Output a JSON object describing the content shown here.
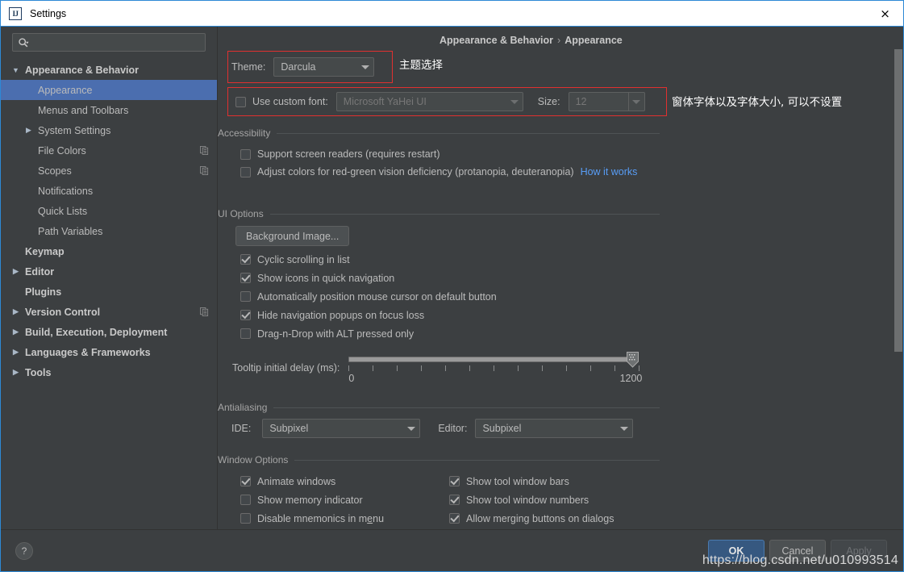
{
  "window": {
    "title": "Settings",
    "app_icon": "intellij-idea-icon",
    "close_label": "×",
    "accent_border": "#2d89d6"
  },
  "sidebar": {
    "search": {
      "placeholder": "",
      "value": "",
      "icon": "search-icon"
    },
    "items": [
      {
        "label": "Appearance & Behavior",
        "indent": 0,
        "twisty": "expanded",
        "bold": true,
        "selected": false,
        "copy": false
      },
      {
        "label": "Appearance",
        "indent": 1,
        "twisty": "none",
        "bold": false,
        "selected": true,
        "copy": false
      },
      {
        "label": "Menus and Toolbars",
        "indent": 1,
        "twisty": "none",
        "bold": false,
        "selected": false,
        "copy": false
      },
      {
        "label": "System Settings",
        "indent": 1,
        "twisty": "collapsed",
        "bold": false,
        "selected": false,
        "copy": false
      },
      {
        "label": "File Colors",
        "indent": 1,
        "twisty": "none",
        "bold": false,
        "selected": false,
        "copy": true
      },
      {
        "label": "Scopes",
        "indent": 1,
        "twisty": "none",
        "bold": false,
        "selected": false,
        "copy": true
      },
      {
        "label": "Notifications",
        "indent": 1,
        "twisty": "none",
        "bold": false,
        "selected": false,
        "copy": false
      },
      {
        "label": "Quick Lists",
        "indent": 1,
        "twisty": "none",
        "bold": false,
        "selected": false,
        "copy": false
      },
      {
        "label": "Path Variables",
        "indent": 1,
        "twisty": "none",
        "bold": false,
        "selected": false,
        "copy": false
      },
      {
        "label": "Keymap",
        "indent": 0,
        "twisty": "none",
        "bold": true,
        "selected": false,
        "copy": false
      },
      {
        "label": "Editor",
        "indent": 0,
        "twisty": "collapsed",
        "bold": true,
        "selected": false,
        "copy": false
      },
      {
        "label": "Plugins",
        "indent": 0,
        "twisty": "none",
        "bold": true,
        "selected": false,
        "copy": false
      },
      {
        "label": "Version Control",
        "indent": 0,
        "twisty": "collapsed",
        "bold": true,
        "selected": false,
        "copy": true
      },
      {
        "label": "Build, Execution, Deployment",
        "indent": 0,
        "twisty": "collapsed",
        "bold": true,
        "selected": false,
        "copy": false
      },
      {
        "label": "Languages & Frameworks",
        "indent": 0,
        "twisty": "collapsed",
        "bold": true,
        "selected": false,
        "copy": false
      },
      {
        "label": "Tools",
        "indent": 0,
        "twisty": "collapsed",
        "bold": true,
        "selected": false,
        "copy": false
      }
    ]
  },
  "breadcrumb": {
    "root": "Appearance & Behavior",
    "separator": "›",
    "leaf": "Appearance"
  },
  "theme_row": {
    "label": "Theme:",
    "value": "Darcula",
    "annotation": "主题选择"
  },
  "font_row": {
    "checkbox_label": "Use custom font:",
    "checked": false,
    "font_value": "Microsoft YaHei UI",
    "size_label": "Size:",
    "size_value": "12",
    "annotation": "窗体字体以及字体大小, 可以不设置"
  },
  "accessibility": {
    "title": "Accessibility",
    "options": [
      {
        "label": "Support screen readers (requires restart)",
        "checked": false
      },
      {
        "label": "Adjust colors for red-green vision deficiency (protanopia, deuteranopia)",
        "checked": false
      }
    ],
    "link": "How it works"
  },
  "ui_options": {
    "title": "UI Options",
    "background_image_button": "Background Image...",
    "options": [
      {
        "label": "Cyclic scrolling in list",
        "checked": true
      },
      {
        "label": "Show icons in quick navigation",
        "checked": true
      },
      {
        "label": "Automatically position mouse cursor on default button",
        "checked": false
      },
      {
        "label": "Hide navigation popups on focus loss",
        "checked": true
      },
      {
        "label": "Drag-n-Drop with ALT pressed only",
        "checked": false
      }
    ],
    "tooltip_delay": {
      "label": "Tooltip initial delay (ms):",
      "min": "0",
      "max": "1200",
      "value": 1200,
      "tick_count": 13
    }
  },
  "antialiasing": {
    "title": "Antialiasing",
    "ide_label": "IDE:",
    "ide_value": "Subpixel",
    "editor_label": "Editor:",
    "editor_value": "Subpixel"
  },
  "window_options": {
    "title": "Window Options",
    "left_column": [
      {
        "label": "Animate windows",
        "checked": true,
        "mnemonic_index": -1
      },
      {
        "label": "Show memory indicator",
        "checked": false,
        "mnemonic_index": -1
      },
      {
        "label": "Disable mnemonics in menu",
        "checked": false,
        "mnemonic_index": 22
      }
    ],
    "right_column": [
      {
        "label": "Show tool window bars",
        "checked": true
      },
      {
        "label": "Show tool window numbers",
        "checked": true
      },
      {
        "label": "Allow merging buttons on dialogs",
        "checked": true
      }
    ]
  },
  "footer": {
    "help_label": "?",
    "ok_label": "OK",
    "cancel_label": "Cancel",
    "apply_label": "Apply",
    "watermark": "https://blog.csdn.net/u010993514"
  }
}
